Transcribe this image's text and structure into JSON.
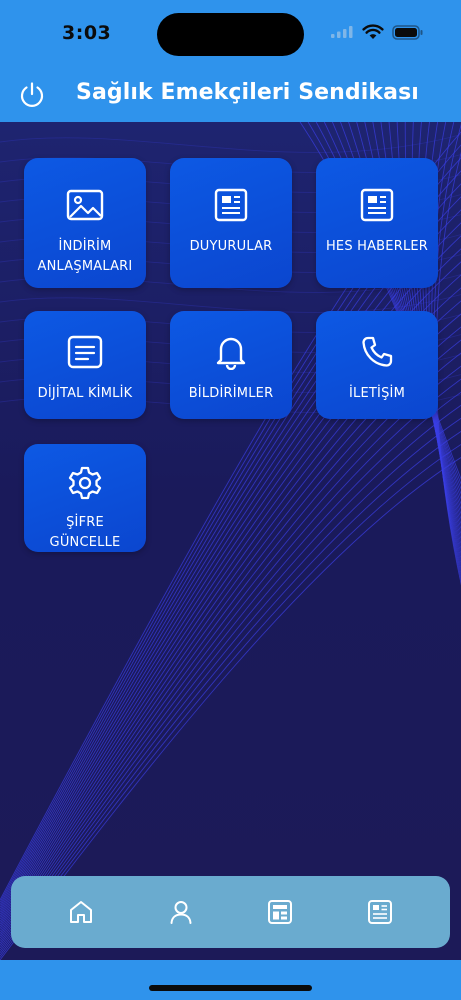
{
  "status_bar": {
    "time": "3:03"
  },
  "header": {
    "title": "Sağlık Emekçileri Sendikası",
    "power_icon": "power-icon"
  },
  "tiles": [
    {
      "label": "İNDİRİM ANLAŞMALARI",
      "icon": "image-icon"
    },
    {
      "label": "DUYURULAR",
      "icon": "newspaper-icon"
    },
    {
      "label": "HES HABERLER",
      "icon": "newspaper-icon"
    },
    {
      "label": "DİJİTAL KİMLİK",
      "icon": "id-card-icon"
    },
    {
      "label": "BİLDİRİMLER",
      "icon": "bell-icon"
    },
    {
      "label": "İLETİŞİM",
      "icon": "phone-icon"
    },
    {
      "label": "ŞİFRE GÜNCELLE",
      "icon": "gear-icon"
    }
  ],
  "tab_bar": {
    "items": [
      "home-icon",
      "user-icon",
      "dashboard-icon",
      "newspaper-icon"
    ]
  },
  "colors": {
    "header_bg": "#2f93ec",
    "tile_bg": "#0b4fd8",
    "content_bg": "#1c1d60",
    "tab_bar_bg": "#6aabcf",
    "wave_lines": "#3b3fe6"
  }
}
